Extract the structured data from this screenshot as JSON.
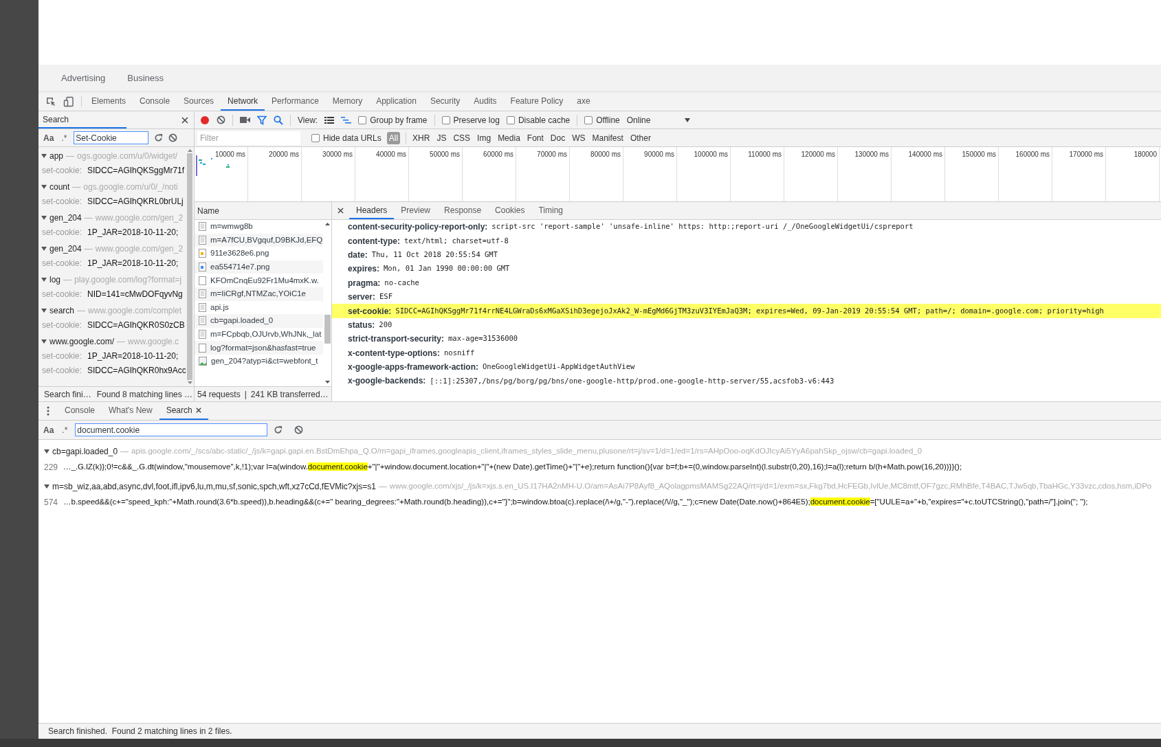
{
  "page_nav": [
    "Advertising",
    "Business"
  ],
  "devtools_tabs": [
    {
      "label": "Elements",
      "selected": false
    },
    {
      "label": "Console",
      "selected": false
    },
    {
      "label": "Sources",
      "selected": false
    },
    {
      "label": "Network",
      "selected": true
    },
    {
      "label": "Performance",
      "selected": false
    },
    {
      "label": "Memory",
      "selected": false
    },
    {
      "label": "Application",
      "selected": false
    },
    {
      "label": "Security",
      "selected": false
    },
    {
      "label": "Audits",
      "selected": false
    },
    {
      "label": "Feature Policy",
      "selected": false
    },
    {
      "label": "axe",
      "selected": false
    }
  ],
  "search_panel": {
    "title": "Search",
    "case_label": "Aa",
    "regex_label": ".*",
    "query": "Set-Cookie",
    "results": [
      {
        "file": "app",
        "separator": "—",
        "url": "ogs.google.com/u/0/widget/",
        "matches": [
          {
            "label": "set-cookie:",
            "value": "SIDCC=AGIhQKSggMr71f"
          }
        ]
      },
      {
        "file": "count",
        "separator": "—",
        "url": "ogs.google.com/u/0/_/noti",
        "matches": [
          {
            "label": "set-cookie:",
            "value": "SIDCC=AGIhQKRL0brULj"
          }
        ]
      },
      {
        "file": "gen_204",
        "separator": "—",
        "url": "www.google.com/gen_2",
        "matches": [
          {
            "label": "set-cookie:",
            "value": "1P_JAR=2018-10-11-20;"
          }
        ]
      },
      {
        "file": "gen_204",
        "separator": "—",
        "url": "www.google.com/gen_2",
        "matches": [
          {
            "label": "set-cookie:",
            "value": "1P_JAR=2018-10-11-20;"
          }
        ]
      },
      {
        "file": "log",
        "separator": "—",
        "url": "play.google.com/log?format=j",
        "matches": [
          {
            "label": "set-cookie:",
            "value": "NID=141=cMwDOFqyvNg"
          }
        ]
      },
      {
        "file": "search",
        "separator": "—",
        "url": "www.google.com/complet",
        "matches": [
          {
            "label": "set-cookie:",
            "value": "SIDCC=AGIhQKR0S0zCB"
          }
        ]
      },
      {
        "file": "www.google.com/",
        "separator": "—",
        "url": "www.google.c",
        "matches": [
          {
            "label": "set-cookie:",
            "value": "1P_JAR=2018-10-11-20;"
          },
          {
            "label": "set-cookie:",
            "value": "SIDCC=AGIhQKR0hx9Acc"
          }
        ]
      }
    ],
    "status": [
      "Search fini…",
      "Found 8 matching lines …"
    ]
  },
  "network_toolbar": {
    "view_label": "View:",
    "checkboxes": [
      {
        "label": "Group by frame",
        "checked": false
      },
      {
        "label": "Preserve log",
        "checked": false
      },
      {
        "label": "Disable cache",
        "checked": false
      },
      {
        "label": "Offline",
        "checked": false
      }
    ],
    "throttle": "Online"
  },
  "filter_bar": {
    "placeholder": "Filter",
    "hide_data_urls": {
      "label": "Hide data URLs",
      "checked": false
    },
    "types": [
      {
        "label": "All",
        "selected": true
      },
      {
        "label": "XHR",
        "selected": false
      },
      {
        "label": "JS",
        "selected": false
      },
      {
        "label": "CSS",
        "selected": false
      },
      {
        "label": "Img",
        "selected": false
      },
      {
        "label": "Media",
        "selected": false
      },
      {
        "label": "Font",
        "selected": false
      },
      {
        "label": "Doc",
        "selected": false
      },
      {
        "label": "WS",
        "selected": false
      },
      {
        "label": "Manifest",
        "selected": false
      },
      {
        "label": "Other",
        "selected": false
      }
    ]
  },
  "timeline": {
    "ticks": [
      "10000 ms",
      "20000 ms",
      "30000 ms",
      "40000 ms",
      "50000 ms",
      "60000 ms",
      "70000 ms",
      "80000 ms",
      "90000 ms",
      "100000 ms",
      "110000 ms",
      "120000 ms",
      "130000 ms",
      "140000 ms",
      "150000 ms",
      "160000 ms",
      "170000 ms",
      "180000"
    ]
  },
  "requests": {
    "column": "Name",
    "rows": [
      {
        "name": "m=wmwg8b",
        "kind": "document"
      },
      {
        "name": "m=A7fCU,BVgquf,D9BKJd,EFQ",
        "kind": "document"
      },
      {
        "name": "911e3628e6.png",
        "kind": "image",
        "color": "#f4b400"
      },
      {
        "name": "ea554714e7.png",
        "kind": "image",
        "color": "#4285f4"
      },
      {
        "name": "KFOmCnqEu92Fr1Mu4mxK.w.",
        "kind": "blank"
      },
      {
        "name": "m=IiCRgf,NTMZac,YOiC1e",
        "kind": "document"
      },
      {
        "name": "api.js",
        "kind": "document"
      },
      {
        "name": "cb=gapi.loaded_0",
        "kind": "document"
      },
      {
        "name": "m=FCpbqb,OJUrvb,WhJNk,_lat",
        "kind": "document"
      },
      {
        "name": "log?format=json&hasfast=true",
        "kind": "blank"
      },
      {
        "name": "gen_204?atyp=i&ct=webfont_t",
        "kind": "picture"
      }
    ],
    "summary": [
      "54 requests",
      "|",
      "241 KB transferred…"
    ]
  },
  "details": {
    "tabs": [
      {
        "label": "Headers",
        "selected": true
      },
      {
        "label": "Preview",
        "selected": false
      },
      {
        "label": "Response",
        "selected": false
      },
      {
        "label": "Cookies",
        "selected": false
      },
      {
        "label": "Timing",
        "selected": false
      }
    ],
    "headers": [
      {
        "name": "content-security-policy-report-only:",
        "value": "script-src 'report-sample' 'unsafe-inline' https: http:;report-uri /_/OneGoogleWidgetUi/cspreport",
        "highlighted": false
      },
      {
        "name": "content-type:",
        "value": "text/html; charset=utf-8",
        "highlighted": false
      },
      {
        "name": "date:",
        "value": "Thu, 11 Oct 2018 20:55:54 GMT",
        "highlighted": false
      },
      {
        "name": "expires:",
        "value": "Mon, 01 Jan 1990 00:00:00 GMT",
        "highlighted": false
      },
      {
        "name": "pragma:",
        "value": "no-cache",
        "highlighted": false
      },
      {
        "name": "server:",
        "value": "ESF",
        "highlighted": false
      },
      {
        "name": "set-cookie:",
        "value": "SIDCC=AGIhQKSggMr71f4rrNE4LGWraDs6xMGaXSihD3egejoJxAk2_W-mEgMd6GjTM3zuV3IYEmJaQ3M; expires=Wed, 09-Jan-2019 20:55:54 GMT; path=/; domain=.google.com; priority=high",
        "highlighted": true
      },
      {
        "name": "status:",
        "value": "200",
        "highlighted": false
      },
      {
        "name": "strict-transport-security:",
        "value": "max-age=31536000",
        "highlighted": false
      },
      {
        "name": "x-content-type-options:",
        "value": "nosniff",
        "highlighted": false
      },
      {
        "name": "x-google-apps-framework-action:",
        "value": "OneGoogleWidgetUi-AppWidgetAuthView",
        "highlighted": false
      },
      {
        "name": "x-google-backends:",
        "value": "[::1]:25307,/bns/pg/borg/pg/bns/one-google-http/prod.one-google-http-server/55,acsfob3-v6:443",
        "highlighted": false
      }
    ]
  },
  "drawer": {
    "tabs": [
      {
        "label": "Console",
        "selected": false,
        "closable": false
      },
      {
        "label": "What's New",
        "selected": false,
        "closable": false
      },
      {
        "label": "Search",
        "selected": true,
        "closable": true
      }
    ],
    "case_label": "Aa",
    "regex_label": ".*",
    "query": "document.cookie",
    "results": [
      {
        "file": "cb=gapi.loaded_0",
        "separator": "—",
        "url": "apis.google.com/_/scs/abc-static/_/js/k=gapi.gapi.en.BstDmEhpa_Q.O/m=gapi_iframes,googleapis_client,iframes_styles_slide_menu,plusone/rt=j/sv=1/d=1/ed=1/rs=AHpOoo-oqKdOJIcyAi5YyA6pahSkp_ojsw/cb=gapi.loaded_0",
        "line_number": "229",
        "code": [
          {
            "text": "…_.G.lZ(k)};0!=c&&_.G.dt(window,\"mousemove\",k,!1);var l=a(window.",
            "match": false
          },
          {
            "text": "document.cookie",
            "match": true
          },
          {
            "text": "+\"|\"+window.document.location+\"|\"+(new Date).getTime()+\"|\"+e);return function(){var b=f;b+=(0,window.parseInt)(l.substr(0,20),16);l=a(l);return b/(h+Math.pow(16,20))}}();",
            "match": false
          }
        ]
      },
      {
        "file": "m=sb_wiz,aa,abd,async,dvl,foot,ifl,ipv6,lu,m,mu,sf,sonic,spch,wft,xz7cCd,fEVMic?xjs=s1",
        "separator": "—",
        "url": "www.google.com/xjs/_/js/k=xjs.s.en_US.I17HA2nMH-U.O/am=AsAi7P8Ayf8_AQolagpmsMAMSg22AQ/rt=j/d=1/exm=sx,Fkg7bd,HcFEGb,IvlUe,MC8mtf,OF7gzc,RMhBfe,T4BAC,TJw5qb,TbaHGc,Y33vzc,cdos,hsm,iDPo",
        "line_number": "574",
        "code": [
          {
            "text": "…b.speed&&(c+=\"speed_kph:\"+Math.round(3.6*b.speed)),b.heading&&(c+=\" bearing_degrees:\"+Math.round(b.heading)),c+=\"}\";b=window.btoa(c).replace(/\\+/g,\"-\").replace(/\\//g,\"_\");c=new Date(Date.now()+864E5);",
            "match": false
          },
          {
            "text": "document.cookie",
            "match": true
          },
          {
            "text": "=[\"UULE=a+\"+b,\"expires=\"+c.toUTCString(),\"path=/\"].join(\"; \");",
            "match": false
          }
        ]
      }
    ],
    "status": "Search finished.  Found 2 matching lines in 2 files."
  }
}
